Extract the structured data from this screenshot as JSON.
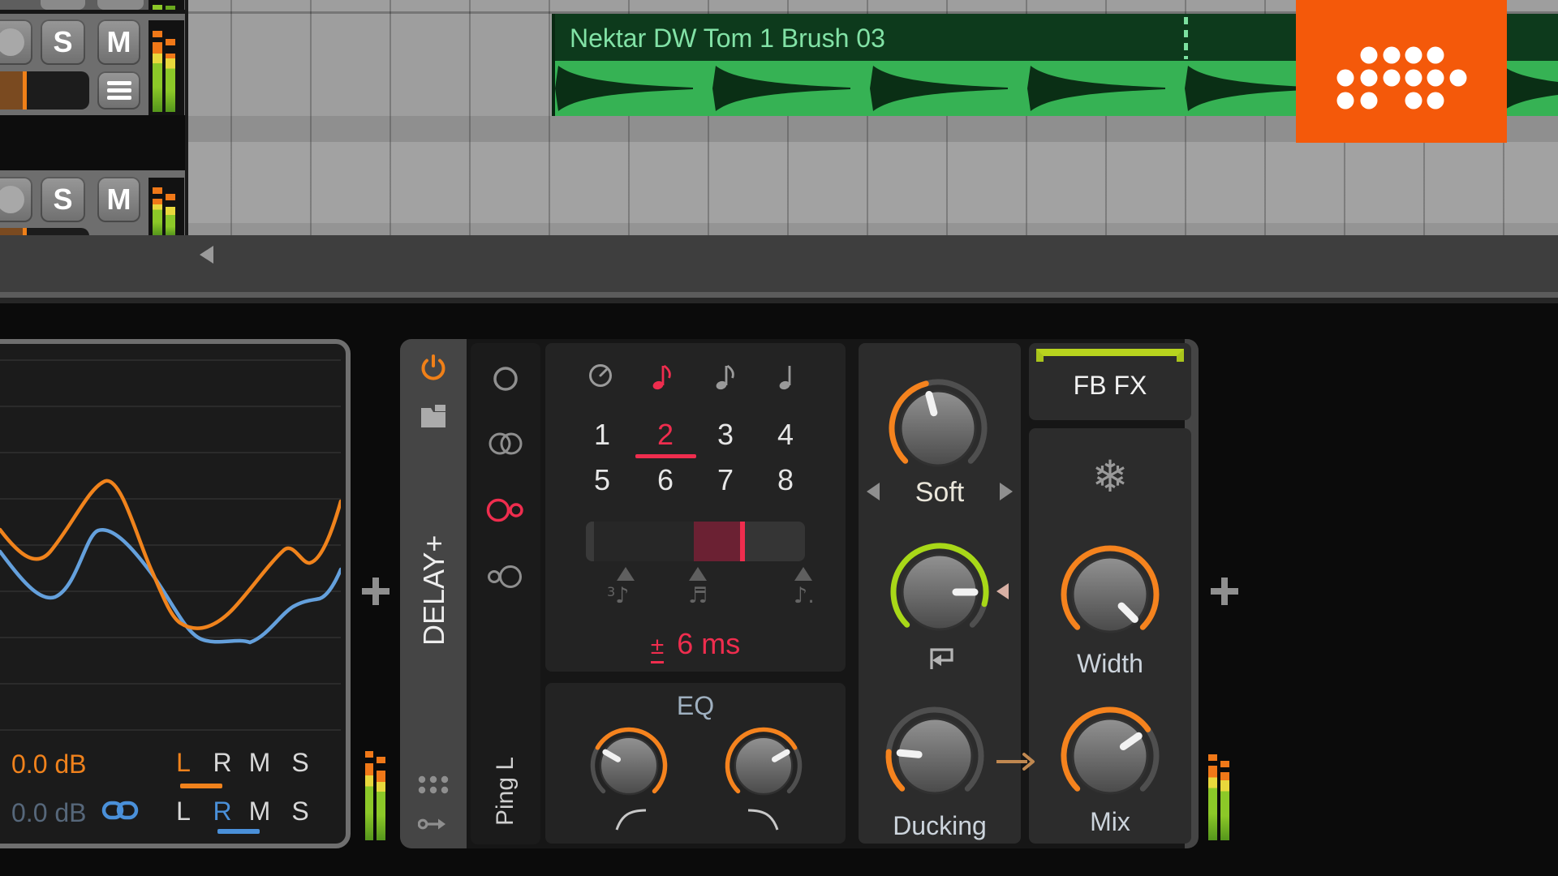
{
  "arrangement": {
    "clip_name": "Nektar DW Tom 1 Brush 03",
    "track1": {
      "solo": "S",
      "mute": "M"
    },
    "track2": {
      "solo": "S",
      "mute": "M"
    }
  },
  "scope_panel": {
    "gain_a": "0.0 dB",
    "gain_b": "0.0 dB",
    "channels_a": [
      "L",
      "R",
      "M",
      "S"
    ],
    "channels_b": [
      "L",
      "R",
      "M",
      "S"
    ]
  },
  "device": {
    "title": "DELAY+",
    "mode_label": "Ping L",
    "steps": [
      "1",
      "2",
      "3",
      "4",
      "5",
      "6",
      "7",
      "8"
    ],
    "selected_step": "2",
    "offset_sign": "±",
    "offset_value": "6 ms",
    "eq_label": "EQ",
    "shape_label": "Soft",
    "ducking_label": "Ducking",
    "fb_fx_label": "FB FX",
    "width_label": "Width",
    "mix_label": "Mix"
  },
  "colors": {
    "accent_orange": "#f08018",
    "accent_red": "#ef2d4e",
    "accent_lime": "#b8d41e",
    "accent_blue": "#4a90d9",
    "clip_green": "#36b254",
    "logo_orange": "#f4590a"
  }
}
